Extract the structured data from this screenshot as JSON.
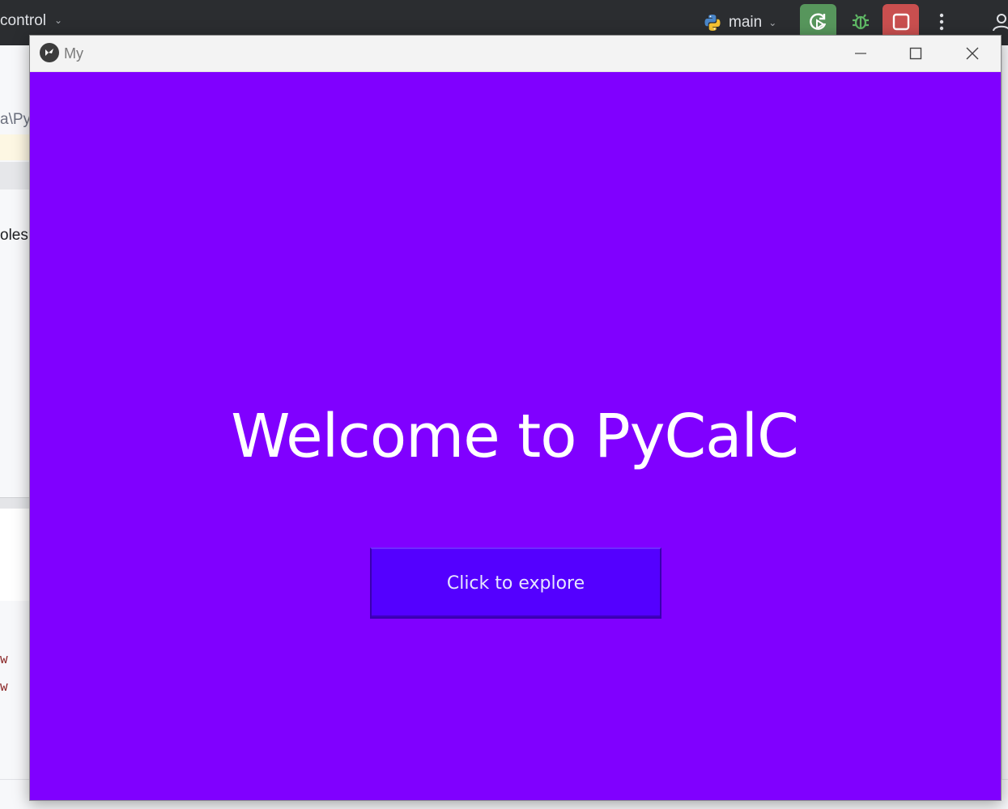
{
  "ide": {
    "version_control_label": "control",
    "run_config_label": "main",
    "left_path_fragment": "a\\Py",
    "left_text_fragment": "oles",
    "left_code_fragment_1": "w",
    "left_code_fragment_2": "w"
  },
  "app_window": {
    "title": "My",
    "heading": "Welcome to PyCalC",
    "button_label": "Click to explore",
    "background_color": "#8000ff",
    "button_color": "#5400ff"
  }
}
